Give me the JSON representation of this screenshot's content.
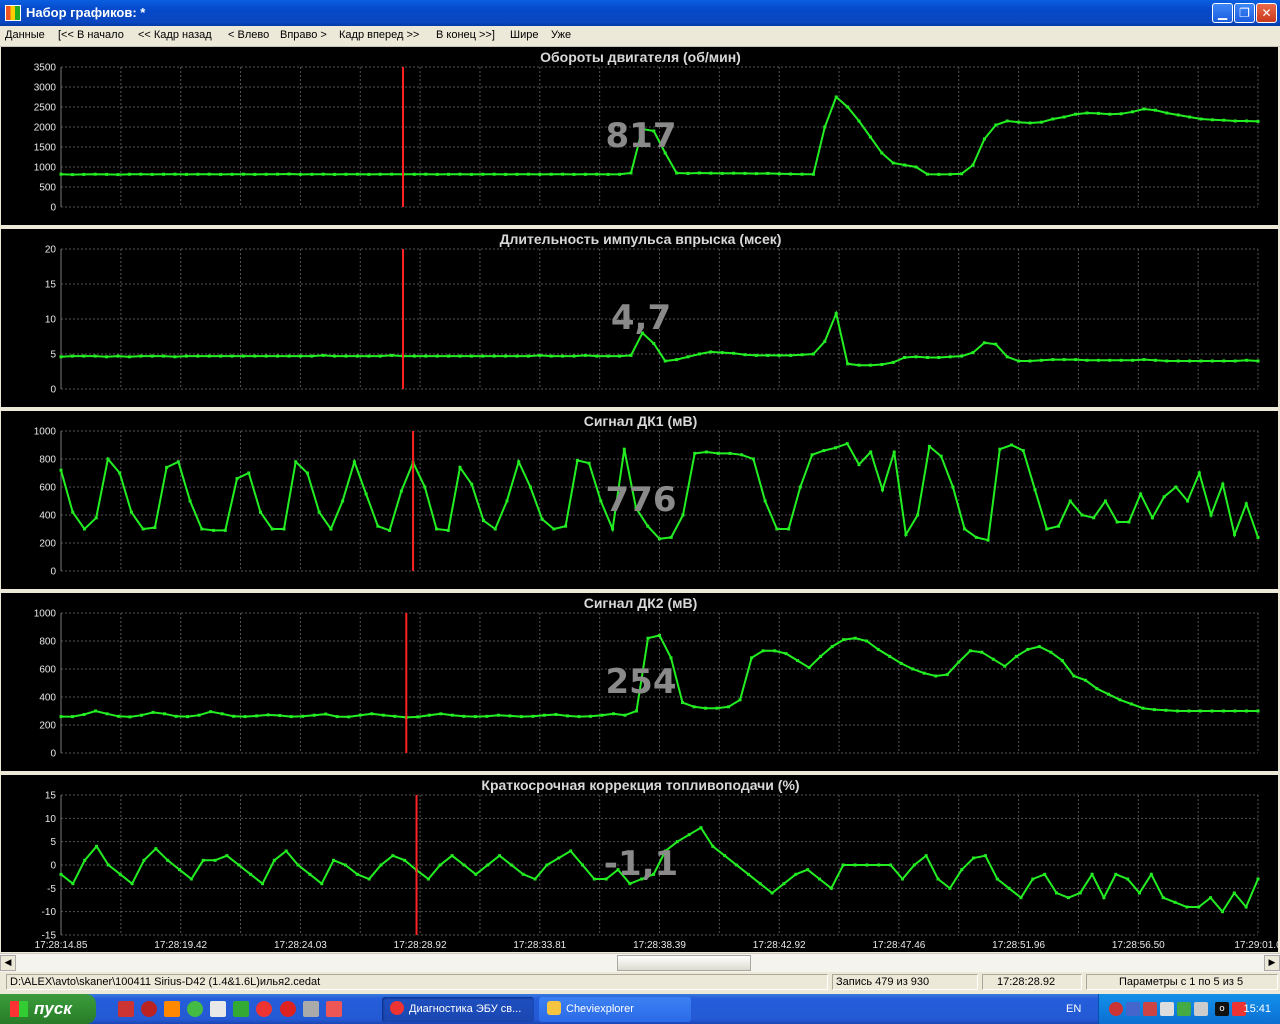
{
  "window": {
    "title": "Набор графиков: *"
  },
  "menu": [
    "Данные",
    "[<< В начало",
    "<< Кадр назад",
    "< Влево",
    "Вправо >",
    "Кадр вперед >>",
    "В конец >>]",
    "Шире",
    "Уже"
  ],
  "colors": {
    "trace": "#22ee22",
    "cursor": "#ff2222",
    "grid": "#555555",
    "value": "#8a8a8a",
    "panel_bg": "#000000"
  },
  "time_axis": [
    "17:28:14.85",
    "17:28:19.42",
    "17:28:24.03",
    "17:28:28.92",
    "17:28:33.81",
    "17:28:38.39",
    "17:28:42.92",
    "17:28:47.46",
    "17:28:51.96",
    "17:28:56.50",
    "17:29:01.0"
  ],
  "cursor_index": 30,
  "charts": [
    {
      "title": "Обороты двигателя  (об/мин)",
      "value": "817",
      "ylim": [
        0,
        3500
      ],
      "yticks": [
        "3500",
        "3000",
        "2500",
        "2000",
        "1500",
        "1000",
        "500",
        "0"
      ],
      "values": [
        820,
        810,
        815,
        820,
        815,
        810,
        818,
        820,
        815,
        818,
        820,
        815,
        818,
        820,
        815,
        817,
        820,
        815,
        818,
        820,
        825,
        815,
        817,
        820,
        815,
        818,
        820,
        815,
        818,
        820,
        817,
        818,
        820,
        815,
        817,
        820,
        815,
        818,
        820,
        815,
        817,
        820,
        815,
        818,
        820,
        815,
        817,
        820,
        815,
        817,
        850,
        1950,
        1900,
        1350,
        850,
        840,
        850,
        845,
        840,
        845,
        840,
        835,
        840,
        830,
        825,
        820,
        818,
        2000,
        2750,
        2500,
        2150,
        1750,
        1350,
        1100,
        1050,
        1000,
        820,
        815,
        817,
        830,
        1050,
        1700,
        2050,
        2150,
        2120,
        2100,
        2120,
        2200,
        2250,
        2320,
        2350,
        2340,
        2320,
        2330,
        2380,
        2450,
        2420,
        2350,
        2300,
        2250,
        2200,
        2180,
        2170,
        2150,
        2150,
        2140
      ]
    },
    {
      "title": "Длительность импульса впрыска  (мсек)",
      "value": "4,7",
      "ylim": [
        0,
        20
      ],
      "yticks": [
        "20",
        "15",
        "10",
        "5",
        "0"
      ],
      "values": [
        4.6,
        4.7,
        4.7,
        4.7,
        4.6,
        4.7,
        4.6,
        4.7,
        4.7,
        4.7,
        4.6,
        4.7,
        4.7,
        4.7,
        4.7,
        4.7,
        4.7,
        4.7,
        4.7,
        4.7,
        4.7,
        4.7,
        4.7,
        4.8,
        4.7,
        4.7,
        4.7,
        4.7,
        4.7,
        4.8,
        4.7,
        4.7,
        4.7,
        4.7,
        4.7,
        4.7,
        4.7,
        4.7,
        4.7,
        4.7,
        4.7,
        4.7,
        4.8,
        4.7,
        4.7,
        4.7,
        4.8,
        4.7,
        4.7,
        4.7,
        4.8,
        8.0,
        6.5,
        4.0,
        4.2,
        4.6,
        5.0,
        5.3,
        5.2,
        5.1,
        4.9,
        4.8,
        4.8,
        4.8,
        4.8,
        4.9,
        5.0,
        6.8,
        10.8,
        3.6,
        3.4,
        3.4,
        3.5,
        3.8,
        4.5,
        4.6,
        4.5,
        4.5,
        4.6,
        4.7,
        5.2,
        6.6,
        6.4,
        4.6,
        4.0,
        4.0,
        4.1,
        4.2,
        4.2,
        4.2,
        4.1,
        4.1,
        4.1,
        4.1,
        4.1,
        4.2,
        4.1,
        4.0,
        4.0,
        4.0,
        4.0,
        4.0,
        4.0,
        4.0,
        4.1,
        4.0
      ]
    },
    {
      "title": "Сигнал ДК1  (мВ)",
      "value": "776",
      "ylim": [
        0,
        1000
      ],
      "yticks": [
        "1000",
        "800",
        "600",
        "400",
        "200",
        "0"
      ],
      "values": [
        720,
        420,
        300,
        380,
        800,
        700,
        420,
        300,
        310,
        740,
        780,
        500,
        300,
        290,
        290,
        660,
        700,
        420,
        300,
        300,
        780,
        700,
        420,
        300,
        500,
        780,
        550,
        320,
        290,
        570,
        776,
        600,
        300,
        290,
        740,
        620,
        360,
        300,
        500,
        780,
        600,
        370,
        300,
        320,
        790,
        770,
        500,
        300,
        870,
        450,
        320,
        230,
        240,
        400,
        840,
        850,
        840,
        840,
        830,
        800,
        500,
        300,
        300,
        600,
        830,
        860,
        880,
        910,
        760,
        850,
        580,
        850,
        260,
        400,
        890,
        820,
        600,
        300,
        240,
        220,
        870,
        900,
        860,
        580,
        300,
        320,
        500,
        400,
        380,
        500,
        350,
        350,
        550,
        380,
        530,
        600,
        500,
        700,
        400,
        620,
        260,
        480,
        240
      ]
    },
    {
      "title": "Сигнал ДК2  (мВ)",
      "value": "254",
      "ylim": [
        0,
        1000
      ],
      "yticks": [
        "1000",
        "800",
        "600",
        "400",
        "200",
        "0"
      ],
      "values": [
        260,
        260,
        275,
        300,
        280,
        262,
        258,
        270,
        290,
        280,
        262,
        260,
        270,
        295,
        280,
        262,
        260,
        265,
        272,
        268,
        260,
        262,
        270,
        278,
        260,
        258,
        270,
        280,
        270,
        262,
        254,
        258,
        270,
        280,
        270,
        262,
        260,
        262,
        270,
        265,
        260,
        262,
        270,
        275,
        265,
        260,
        262,
        270,
        280,
        270,
        300,
        820,
        840,
        680,
        360,
        330,
        320,
        320,
        330,
        380,
        680,
        730,
        730,
        710,
        660,
        610,
        690,
        760,
        810,
        820,
        800,
        740,
        690,
        640,
        600,
        570,
        550,
        560,
        650,
        730,
        720,
        670,
        620,
        690,
        740,
        760,
        720,
        660,
        550,
        520,
        460,
        420,
        380,
        350,
        320,
        310,
        305,
        300,
        300,
        300,
        300,
        300,
        300,
        300,
        300
      ]
    },
    {
      "title": "Краткосрочная коррекция топливоподачи  (%)",
      "value": "-1,1",
      "ylim": [
        -15,
        15
      ],
      "yticks": [
        "15",
        "10",
        "5",
        "0",
        "-5",
        "-10",
        "-15"
      ],
      "values": [
        -2,
        -4,
        1,
        4,
        0,
        -2,
        -4,
        1,
        3.5,
        1,
        -1,
        -3,
        1,
        1,
        2,
        0,
        -2,
        -4,
        1,
        3,
        0,
        -2,
        -4,
        1,
        0,
        -2,
        -3,
        0,
        2,
        1,
        -1.1,
        -3,
        0,
        2,
        0,
        -2,
        0,
        2,
        0,
        -2,
        -3,
        0,
        1.5,
        3,
        0,
        -3,
        -3,
        -1,
        -4,
        -3,
        -2,
        3,
        5,
        6.5,
        8,
        4,
        2,
        0,
        -2,
        -4,
        -6,
        -4,
        -2,
        -1,
        -3,
        -5,
        0,
        0,
        0,
        0,
        0,
        -3,
        0,
        2,
        -3,
        -5,
        -1,
        1.5,
        2,
        -3,
        -5,
        -7,
        -3,
        -2,
        -6,
        -7,
        -6,
        -2,
        -7,
        -2,
        -3,
        -6,
        -2,
        -7,
        -8,
        -9,
        -9,
        -7,
        -10,
        -6,
        -9,
        -3
      ]
    }
  ],
  "status": {
    "file": "D:\\ALEX\\avto\\skaner\\100411 Sirius-D42 (1.4&1.6L)илья2.cedat",
    "record": "Запись 479 из 930",
    "time": "17:28:28.92",
    "params": "Параметры с 1 по 5 из 5"
  },
  "taskbar": {
    "start": "пуск",
    "tasks": [
      "Диагностика ЭБУ св...",
      "Cheviexplorer"
    ],
    "lang": "EN",
    "clock": "15:41"
  },
  "icons": {
    "app": "chart-app-icon",
    "minimize": "minimize-icon",
    "maximize": "restore-icon",
    "close": "close-icon",
    "scroll_left": "arrow-left-icon",
    "scroll_right": "arrow-right-icon"
  }
}
